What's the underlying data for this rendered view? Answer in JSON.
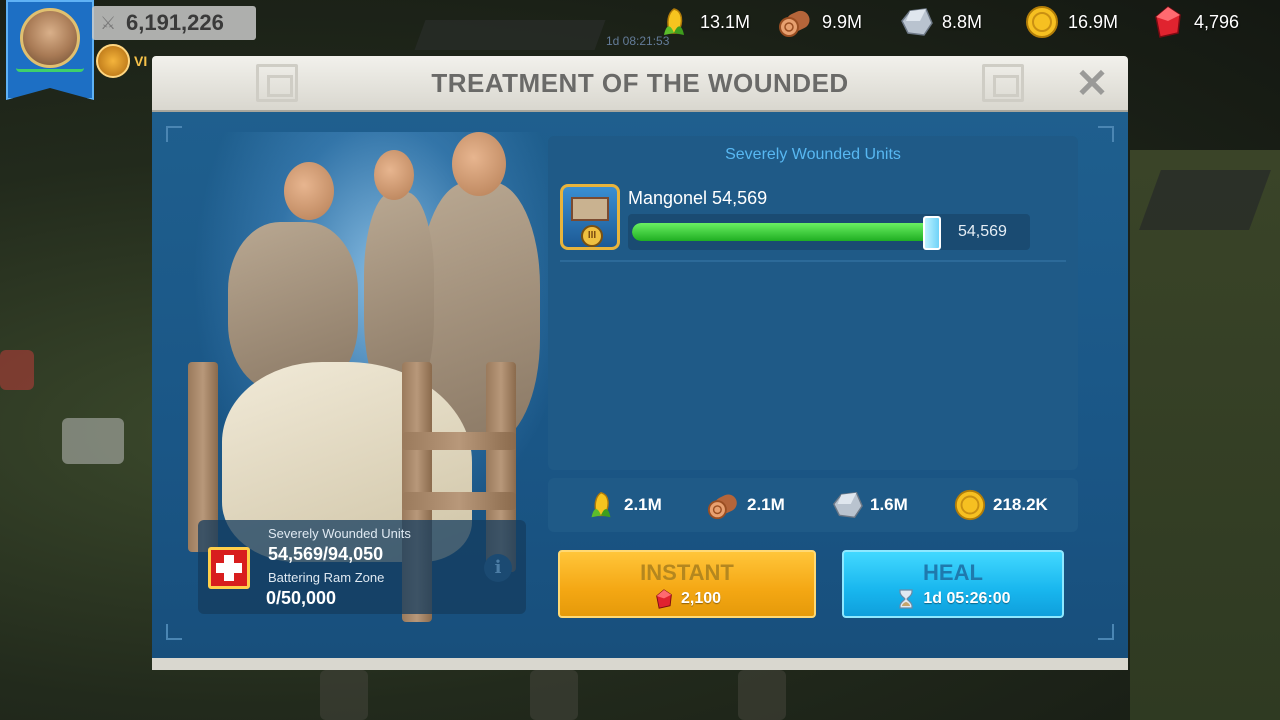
{
  "hud": {
    "power": "6,191,226",
    "vip_label": "VI",
    "background_timer": "1d 08:21:53",
    "resources": [
      {
        "icon": "corn-icon",
        "value": "13.1M"
      },
      {
        "icon": "wood-log-icon",
        "value": "9.9M"
      },
      {
        "icon": "stone-icon",
        "value": "8.8M"
      },
      {
        "icon": "gold-coin-icon",
        "value": "16.9M"
      },
      {
        "icon": "gem-icon",
        "value": "4,796"
      }
    ]
  },
  "modal": {
    "title": "TREATMENT OF THE WOUNDED",
    "list_header": "Severely Wounded Units",
    "units": [
      {
        "name": "Mangonel 54,569",
        "slider_value": "54,569",
        "fill_fraction": 1.0,
        "tier": "III"
      }
    ],
    "info": {
      "wounded_label": "Severely Wounded Units",
      "wounded_value": "54,569/94,050",
      "zone_label": "Battering Ram Zone",
      "zone_value": "0/50,000"
    },
    "costs": [
      {
        "icon": "corn-icon",
        "value": "2.1M"
      },
      {
        "icon": "wood-log-icon",
        "value": "2.1M"
      },
      {
        "icon": "stone-icon",
        "value": "1.6M"
      },
      {
        "icon": "gold-coin-icon",
        "value": "218.2K"
      }
    ],
    "instant_button": {
      "label": "INSTANT",
      "cost": "2,100"
    },
    "heal_button": {
      "label": "HEAL",
      "time": "1d 05:26:00"
    }
  },
  "colors": {
    "panel_blue": "#1f5f8e",
    "instant_orange": "#f4a713",
    "heal_cyan": "#18b6ee",
    "progress_green": "#1fae22"
  }
}
